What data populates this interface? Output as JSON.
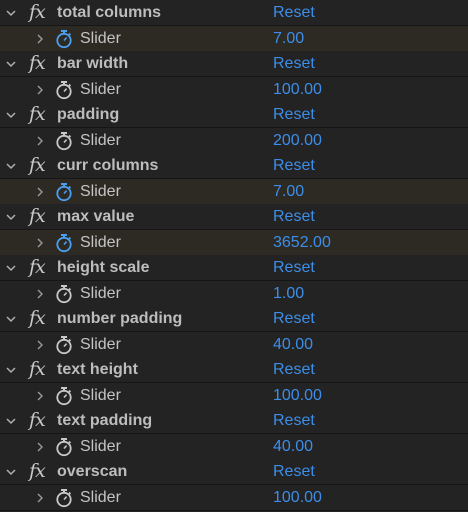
{
  "effects": [
    {
      "name": "total columns",
      "reset_label": "Reset",
      "param_label": "Slider",
      "value": "7.00",
      "animated": true
    },
    {
      "name": "bar width",
      "reset_label": "Reset",
      "param_label": "Slider",
      "value": "100.00",
      "animated": false
    },
    {
      "name": "padding",
      "reset_label": "Reset",
      "param_label": "Slider",
      "value": "200.00",
      "animated": false
    },
    {
      "name": "curr columns",
      "reset_label": "Reset",
      "param_label": "Slider",
      "value": "7.00",
      "animated": true
    },
    {
      "name": "max value",
      "reset_label": "Reset",
      "param_label": "Slider",
      "value": "3652.00",
      "animated": true
    },
    {
      "name": "height scale",
      "reset_label": "Reset",
      "param_label": "Slider",
      "value": "1.00",
      "animated": false
    },
    {
      "name": "number padding",
      "reset_label": "Reset",
      "param_label": "Slider",
      "value": "40.00",
      "animated": false
    },
    {
      "name": "text height",
      "reset_label": "Reset",
      "param_label": "Slider",
      "value": "100.00",
      "animated": false
    },
    {
      "name": "text padding",
      "reset_label": "Reset",
      "param_label": "Slider",
      "value": "40.00",
      "animated": false
    },
    {
      "name": "overscan",
      "reset_label": "Reset",
      "param_label": "Slider",
      "value": "100.00",
      "animated": false
    }
  ],
  "fx_symbol": "fx",
  "colors": {
    "background": "#232323",
    "keyed_row": "#2d2a24",
    "link_blue": "#3d8ee8",
    "stopwatch_animated": "#4a9ff0",
    "stopwatch_static": "#c8c8c8"
  }
}
